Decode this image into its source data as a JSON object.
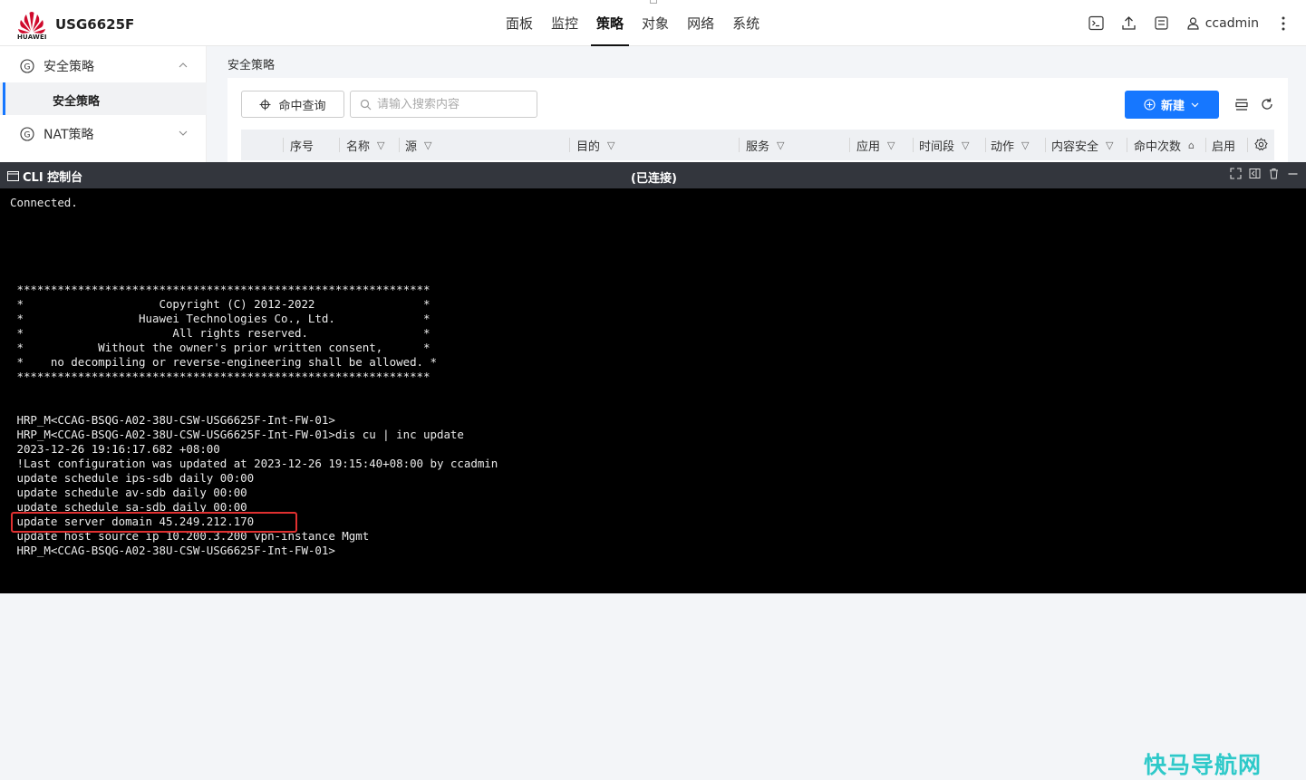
{
  "brand": {
    "logo_text": "HUAWEI",
    "product": "USG6625F"
  },
  "nav": [
    "面板",
    "监控",
    "策略",
    "对象",
    "网络",
    "系统"
  ],
  "nav_active": "策略",
  "user": {
    "name": "ccadmin"
  },
  "sidebar": {
    "items": [
      {
        "label": "安全策略",
        "expanded": true
      },
      {
        "label": "安全策略",
        "sub": true,
        "selected": true
      },
      {
        "label": "NAT策略",
        "expanded": false
      }
    ]
  },
  "breadcrumb": "安全策略",
  "toolbar": {
    "hit_query": "命中查询",
    "search_placeholder": "请输入搜索内容",
    "new_label": "新建"
  },
  "table": {
    "columns": [
      "序号",
      "名称",
      "源",
      "目的",
      "服务",
      "应用",
      "时间段",
      "动作",
      "内容安全",
      "命中次数",
      "启用"
    ]
  },
  "cli": {
    "title": "CLI 控制台",
    "status": "(已连接)",
    "lines": [
      "Connected.",
      "",
      "",
      "",
      "",
      "",
      " *************************************************************",
      " *                    Copyright (C) 2012-2022                *",
      " *                 Huawei Technologies Co., Ltd.             *",
      " *                      All rights reserved.                 *",
      " *           Without the owner's prior written consent,      *",
      " *    no decompiling or reverse-engineering shall be allowed. *",
      " *************************************************************",
      "",
      "",
      " HRP_M<CCAG-BSQG-A02-38U-CSW-USG6625F-Int-FW-01>",
      " HRP_M<CCAG-BSQG-A02-38U-CSW-USG6625F-Int-FW-01>dis cu | inc update",
      " 2023-12-26 19:16:17.682 +08:00",
      " !Last configuration was updated at 2023-12-26 19:15:40+08:00 by ccadmin",
      " update schedule ips-sdb daily 00:00",
      " update schedule av-sdb daily 00:00",
      " update schedule sa-sdb daily 00:00",
      " update server domain 45.249.212.170",
      " update host source ip 10.200.3.200 vpn-instance Mgmt",
      " HRP_M<CCAG-BSQG-A02-38U-CSW-USG6625F-Int-FW-01>"
    ]
  },
  "watermark": "快马导航网",
  "colors": {
    "accent": "#1677ff",
    "highlight": "#e03030",
    "watermark": "#2ec9c9",
    "terminal_bg": "#000000"
  }
}
